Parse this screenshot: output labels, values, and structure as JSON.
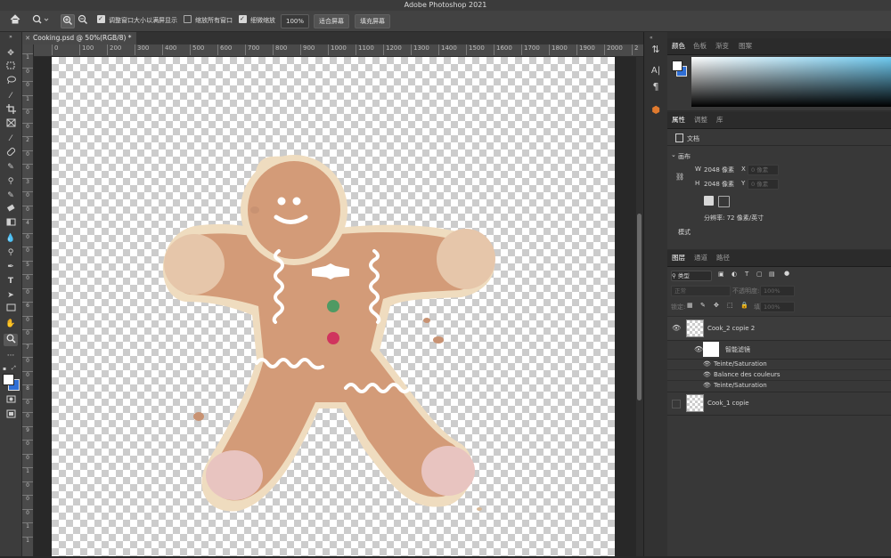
{
  "app": {
    "title": "Adobe Photoshop 2021"
  },
  "options_bar": {
    "fit_window_label": "调整窗口大小以满屏显示",
    "zoom_all_label": "缩放所有窗口",
    "scrubby_label": "细微缩放",
    "zoom_value": "100%",
    "fit_screen_label": "适合屏幕",
    "fill_screen_label": "填充屏幕"
  },
  "document": {
    "tab_title": "Cooking.psd @ 50%(RGB/8) *"
  },
  "rulers": {
    "horizontal": [
      "0",
      "100",
      "200",
      "300",
      "400",
      "500",
      "600",
      "700",
      "800",
      "900",
      "1000",
      "1100",
      "1200",
      "1300",
      "1400",
      "1500",
      "1600",
      "1700",
      "1800",
      "1900",
      "2000",
      "2"
    ],
    "vertical": [
      "1",
      "0",
      "0",
      "1",
      "0",
      "0",
      "2",
      "0",
      "0",
      "3",
      "0",
      "0",
      "4",
      "0",
      "0",
      "5",
      "0",
      "0",
      "6",
      "0",
      "0",
      "7",
      "0",
      "0",
      "8",
      "0",
      "0",
      "9",
      "0",
      "0",
      "1",
      "0",
      "0",
      "0",
      "1",
      "1"
    ]
  },
  "color_panel": {
    "tabs": [
      "颜色",
      "色板",
      "渐变",
      "图案"
    ]
  },
  "properties_panel": {
    "tabs": [
      "属性",
      "调整",
      "库"
    ],
    "doc_label": "文档",
    "section": "画布",
    "w_label": "W",
    "w_value": "2048 像素",
    "h_label": "H",
    "h_value": "2048 像素",
    "x_label": "X",
    "x_value": "0 像素",
    "y_label": "Y",
    "y_value": "0 像素",
    "resolution": "分辨率: 72 像素/英寸",
    "mode": "模式"
  },
  "layers_panel": {
    "tabs": [
      "图层",
      "通道",
      "路径"
    ],
    "filter_kind": "类型",
    "blend_mode": "正常",
    "opacity_label": "不透明度:",
    "opacity_value": "100%",
    "lock_label": "锁定:",
    "fill_label": "填充:",
    "fill_value": "100%",
    "layers": [
      {
        "name": "Cook_2 copie 2"
      },
      {
        "name": "智能滤镜"
      },
      {
        "name": "Teinte/Saturation"
      },
      {
        "name": "Balance des couleurs"
      },
      {
        "name": "Teinte/Saturation"
      },
      {
        "name": "Cook_1 copie"
      }
    ]
  },
  "colors": {
    "foreground": "#ffffff",
    "background": "#2f6fd6",
    "cookie": "#d39b78",
    "icing": "#ffffff"
  }
}
